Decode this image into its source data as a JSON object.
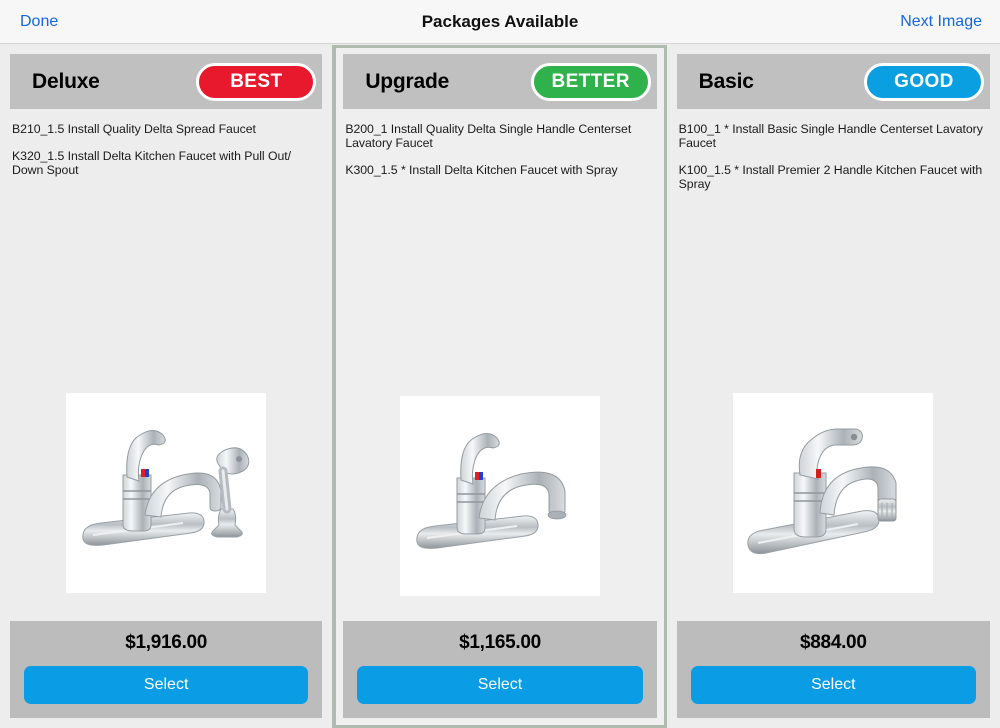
{
  "navbar": {
    "done_label": "Done",
    "title": "Packages Available",
    "next_label": "Next Image",
    "link_color": "#1268e0"
  },
  "packages": [
    {
      "tier": "Deluxe",
      "badge": "BEST",
      "badge_color": "#e8192c",
      "selected": false,
      "specs": [
        "B210_1.5  Install Quality Delta Spread Faucet",
        "K320_1.5  Install Delta Kitchen Faucet with Pull Out/ Down Spout"
      ],
      "image": "kitchen-faucet-with-side-sprayer",
      "price": "$1,916.00",
      "select_label": "Select"
    },
    {
      "tier": "Upgrade",
      "badge": "BETTER",
      "badge_color": "#2fb24c",
      "selected": true,
      "specs": [
        "B200_1  Install Quality Delta Single Handle Centerset Lavatory Faucet",
        "K300_1.5 * Install Delta Kitchen Faucet with Spray"
      ],
      "image": "kitchen-faucet-single-handle",
      "price": "$1,165.00",
      "select_label": "Select"
    },
    {
      "tier": "Basic",
      "badge": "GOOD",
      "badge_color": "#0a9fe0",
      "selected": false,
      "specs": [
        "B100_1 * Install Basic Single Handle Centerset Lavatory Faucet",
        "K100_1.5 * Install Premier 2 Handle Kitchen Faucet with Spray"
      ],
      "image": "kitchen-faucet-basic-pullout",
      "price": "$884.00",
      "select_label": "Select"
    }
  ]
}
